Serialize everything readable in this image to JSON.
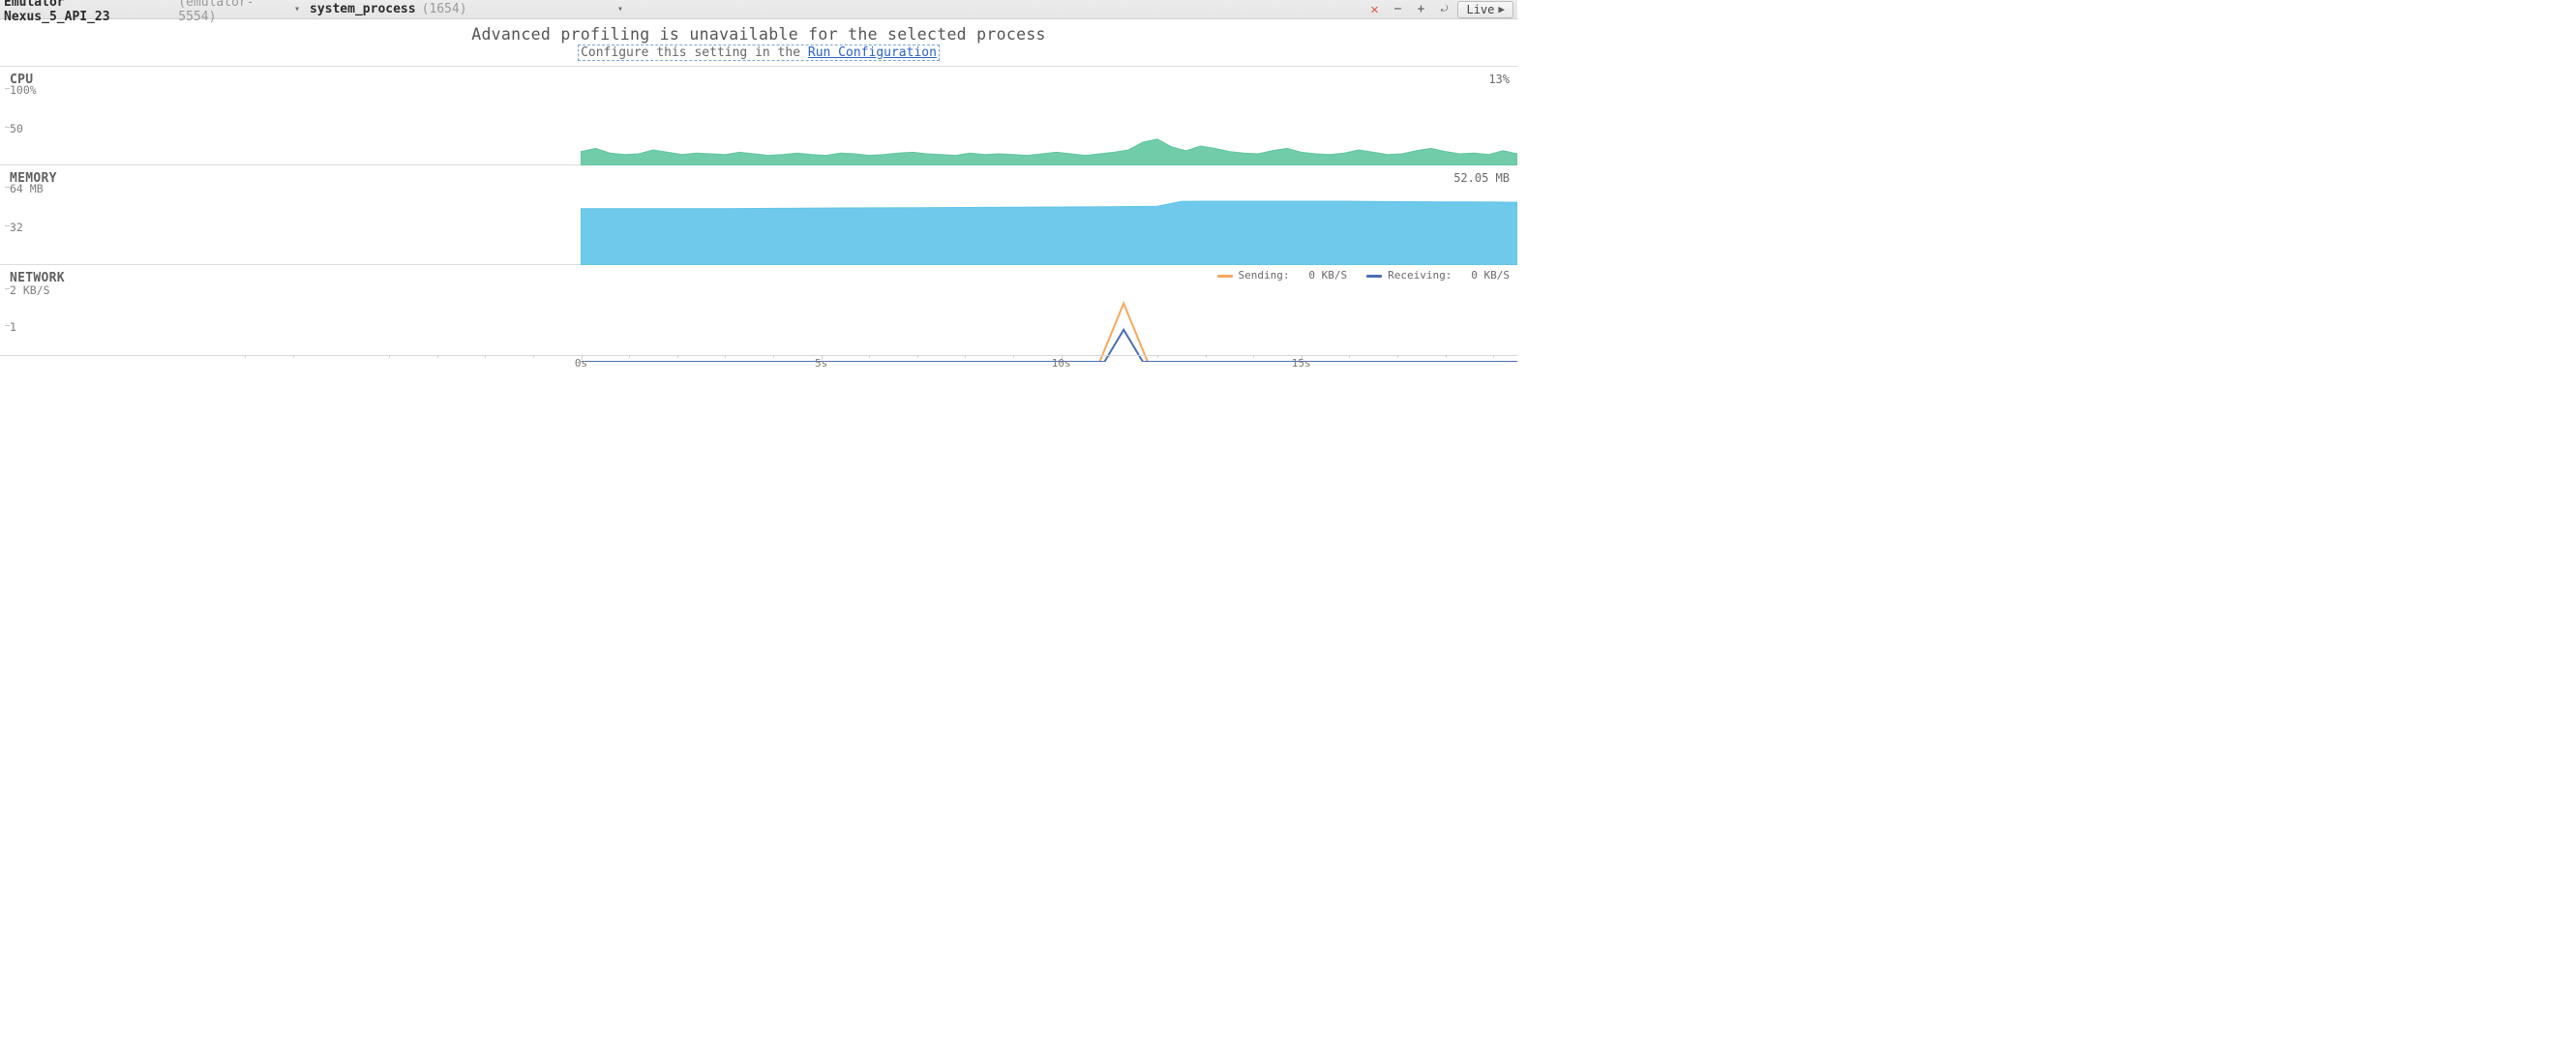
{
  "toolbar": {
    "device_name": "Emulator Nexus_5_API_23",
    "device_id": "(emulator-5554)",
    "process_name": "system_process",
    "process_pid": "(1654)",
    "live_label": "Live"
  },
  "banner": {
    "main": "Advanced profiling is unavailable for the selected process",
    "sub_prefix": "Configure this setting in the ",
    "link_text": "Run Configuration"
  },
  "panels": {
    "cpu": {
      "title": "CPU",
      "value": "13%",
      "y_ticks": [
        "100%",
        "50"
      ],
      "ylim": [
        0,
        100
      ]
    },
    "memory": {
      "title": "MEMORY",
      "value": "52.05 MB",
      "y_ticks": [
        "64 MB",
        "32"
      ],
      "ylim": [
        0,
        64
      ]
    },
    "network": {
      "title": "NETWORK",
      "y_ticks": [
        "2 KB/S",
        "1"
      ],
      "ylim": [
        0,
        2
      ],
      "legend": {
        "sending_label": "Sending:",
        "sending_value": "0 KB/S",
        "receiving_label": "Receiving:",
        "receiving_value": "0 KB/S"
      }
    }
  },
  "time_axis": {
    "labels": [
      "0s",
      "5s",
      "10s",
      "15s"
    ],
    "start_x_frac": 0.383,
    "span_frac": 0.617
  },
  "chart_data": [
    {
      "type": "area",
      "title": "CPU",
      "ylabel": "%",
      "ylim": [
        0,
        100
      ],
      "x_unit": "s",
      "x_range": [
        -7.5,
        19.5
      ],
      "series": [
        {
          "name": "CPU",
          "color": "#62c6a0",
          "x": [
            0,
            0.3,
            0.6,
            0.9,
            1.2,
            1.5,
            1.8,
            2.1,
            2.4,
            2.7,
            3.0,
            3.3,
            3.6,
            3.9,
            4.2,
            4.5,
            4.8,
            5.1,
            5.4,
            5.7,
            6.0,
            6.3,
            6.6,
            6.9,
            7.2,
            7.5,
            7.8,
            8.1,
            8.4,
            8.7,
            9.0,
            9.3,
            9.6,
            9.9,
            10.2,
            10.5,
            10.8,
            11.1,
            11.4,
            11.7,
            12.0,
            12.3,
            12.6,
            12.9,
            13.2,
            13.5,
            13.8,
            14.1,
            14.4,
            14.7,
            15.0,
            15.3,
            15.6,
            15.9,
            16.2,
            16.5,
            16.8,
            17.1,
            17.4,
            17.7,
            18.0,
            18.3,
            18.6,
            18.9,
            19.2,
            19.5
          ],
          "values": [
            18,
            22,
            16,
            14,
            15,
            20,
            17,
            14,
            16,
            15,
            14,
            17,
            15,
            13,
            14,
            16,
            14,
            13,
            16,
            15,
            13,
            14,
            16,
            17,
            15,
            14,
            13,
            16,
            14,
            15,
            14,
            13,
            15,
            17,
            15,
            13,
            15,
            17,
            20,
            30,
            34,
            24,
            19,
            25,
            22,
            18,
            16,
            15,
            19,
            22,
            17,
            15,
            14,
            16,
            20,
            17,
            14,
            15,
            19,
            22,
            18,
            15,
            16,
            14,
            19,
            15
          ]
        }
      ]
    },
    {
      "type": "area",
      "title": "MEMORY",
      "ylabel": "MB",
      "ylim": [
        0,
        64
      ],
      "x_unit": "s",
      "x_range": [
        -7.5,
        19.5
      ],
      "series": [
        {
          "name": "Memory",
          "color": "#5ec3e8",
          "x": [
            0,
            1,
            2,
            3,
            4,
            5,
            6,
            7,
            8,
            9,
            10,
            11,
            12,
            12.5,
            13,
            14,
            15,
            16,
            17,
            18,
            19,
            19.5
          ],
          "values": [
            46,
            46,
            46,
            46,
            46.3,
            46.5,
            46.7,
            46.8,
            47,
            47.2,
            47.4,
            47.6,
            48,
            52,
            52.1,
            52.1,
            52.1,
            52.1,
            51.8,
            51.6,
            51.5,
            51.3
          ]
        }
      ]
    },
    {
      "type": "line",
      "title": "NETWORK",
      "ylabel": "KB/S",
      "ylim": [
        0,
        2
      ],
      "x_unit": "s",
      "x_range": [
        -7.5,
        19.5
      ],
      "series": [
        {
          "name": "Sending",
          "color": "#f4a95d",
          "x": [
            0,
            10.8,
            11.3,
            11.8,
            19.5
          ],
          "values": [
            0,
            0,
            1.55,
            0,
            0
          ]
        },
        {
          "name": "Receiving",
          "color": "#4a6fb3",
          "x": [
            0,
            10.9,
            11.3,
            11.7,
            19.5
          ],
          "values": [
            0,
            0,
            0.85,
            0,
            0
          ]
        }
      ]
    }
  ]
}
